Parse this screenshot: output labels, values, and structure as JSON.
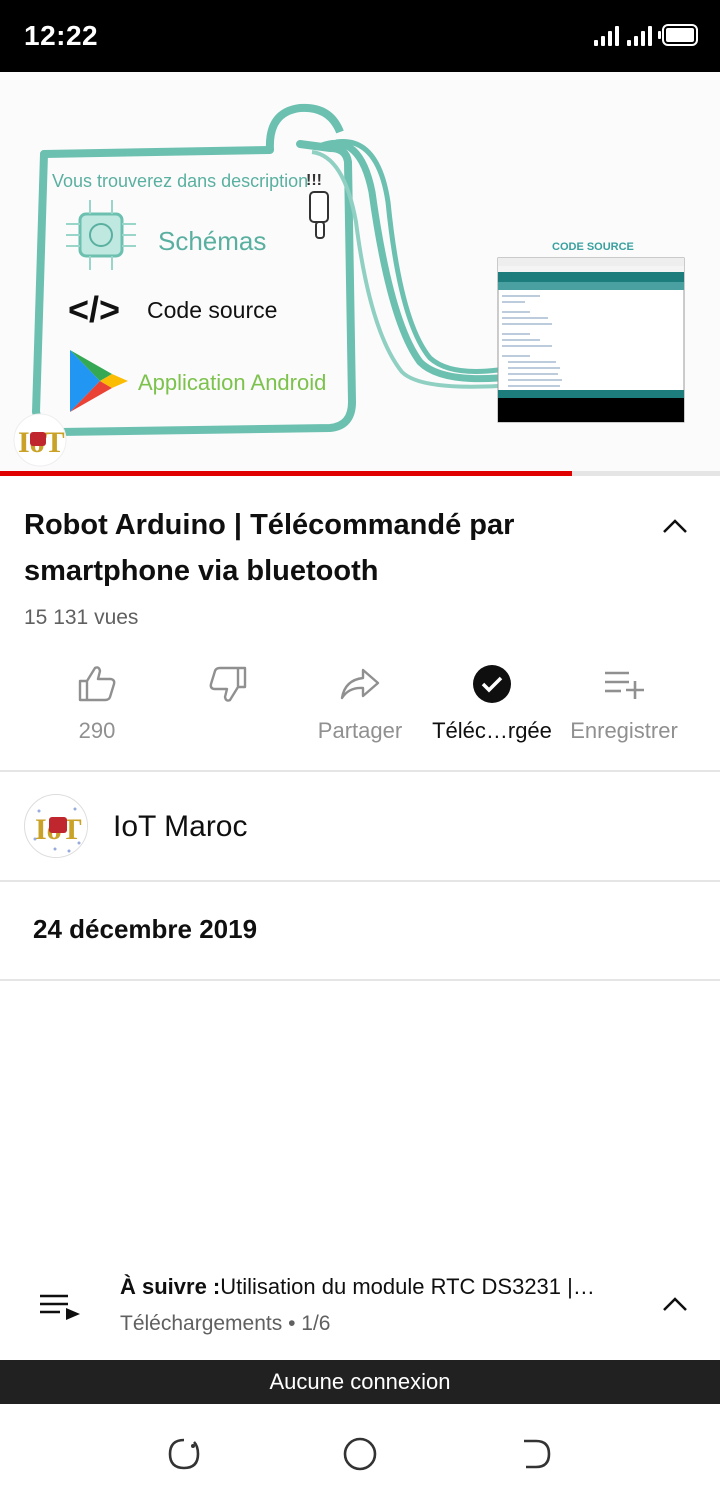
{
  "status_bar": {
    "time": "12:22"
  },
  "video": {
    "thumbnail": {
      "header": "Vous trouverez dans description",
      "exclaim": "!!!",
      "items": [
        "Schémas",
        "Code source",
        "Application Android"
      ],
      "code_label": "CODE SOURCE",
      "logo_text": "IoT"
    },
    "progress_fraction": 0.795,
    "title": "Robot Arduino | Télécommandé par smartphone via bluetooth",
    "views": "15 131 vues"
  },
  "actions": {
    "like_count": "290",
    "share_label": "Partager",
    "download_label": "Téléc…rgée",
    "save_label": "Enregistrer"
  },
  "channel": {
    "name": "IoT Maroc",
    "avatar_text": "IoT"
  },
  "publish_date": "24 décembre 2019",
  "up_next": {
    "prefix": "À suivre :",
    "title": "Utilisation du module RTC DS3231 |…",
    "playlist": "Téléchargements • 1/6"
  },
  "connection_banner": "Aucune connexion",
  "colors": {
    "accent_red": "#e00000",
    "teal": "#6cc0b0",
    "green_text": "#7cc24c"
  },
  "icons": [
    "like-icon",
    "dislike-icon",
    "share-icon",
    "download-done-icon",
    "save-playlist-icon",
    "chevron-up-icon",
    "queue-icon"
  ]
}
